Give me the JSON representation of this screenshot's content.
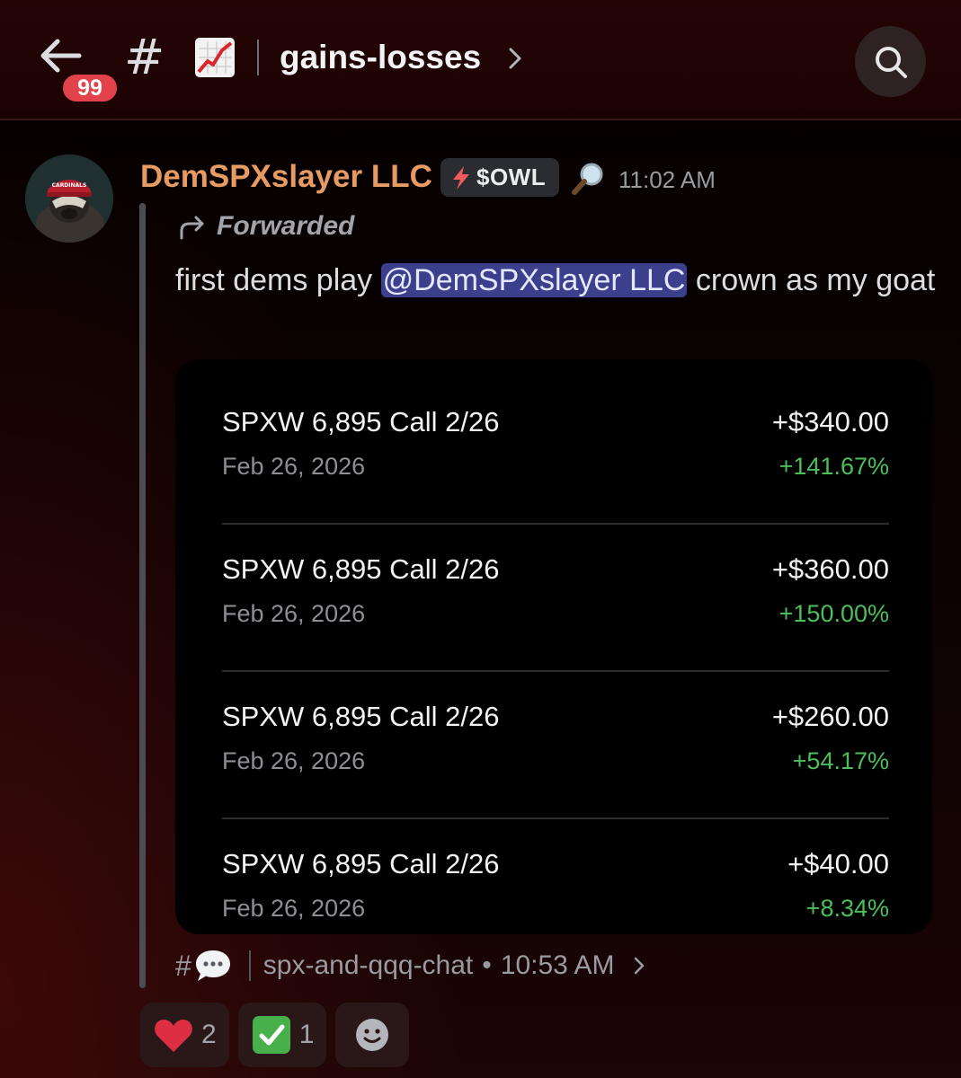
{
  "header": {
    "back_badge": "99",
    "channel_name": "gains-losses"
  },
  "message": {
    "author": "DemSPXslayer LLC",
    "tag": "$OWL",
    "timestamp": "11:02 AM",
    "forwarded_label": "Forwarded",
    "text_before": "first dems play ",
    "mention": "@DemSPXslayer LLC",
    "text_after": " crown as my goat"
  },
  "trades": [
    {
      "title": "SPXW 6,895 Call 2/26",
      "date": "Feb 26, 2026",
      "amount": "+$340.00",
      "percent": "+141.67%"
    },
    {
      "title": "SPXW 6,895 Call 2/26",
      "date": "Feb 26, 2026",
      "amount": "+$360.00",
      "percent": "+150.00%"
    },
    {
      "title": "SPXW 6,895 Call 2/26",
      "date": "Feb 26, 2026",
      "amount": "+$260.00",
      "percent": "+54.17%"
    },
    {
      "title": "SPXW 6,895 Call 2/26",
      "date": "Feb 26, 2026",
      "amount": "+$40.00",
      "percent": "+8.34%"
    }
  ],
  "source": {
    "channel": "spx-and-qqq-chat",
    "time": "10:53 AM"
  },
  "reactions": [
    {
      "emoji": "heart",
      "count": "2"
    },
    {
      "emoji": "check-mark",
      "count": "1"
    }
  ],
  "colors": {
    "author": "#e69b63",
    "mention_bg": "#3b3f8c",
    "gain_green": "#4cbf5a",
    "badge_red": "#e2434b"
  }
}
